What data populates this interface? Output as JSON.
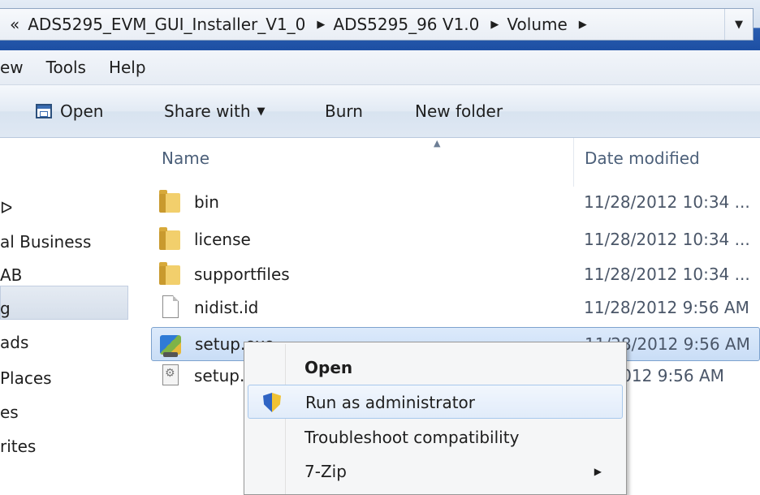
{
  "address_bar": {
    "overflow_glyph": "«",
    "breadcrumbs": [
      "ADS5295_EVM_GUI_Installer_V1_0",
      "ADS5295_96 V1.0",
      "Volume"
    ],
    "separator_glyph": "▶",
    "dropdown_glyph": "▼"
  },
  "menu": {
    "items": [
      "ew",
      "Tools",
      "Help"
    ]
  },
  "toolbar": {
    "open_label": "Open",
    "share_label": "Share with",
    "share_caret": "▼",
    "burn_label": "Burn",
    "new_folder_label": "New folder"
  },
  "nav": {
    "items": [
      "",
      "al Business",
      "AB",
      "g",
      "ads",
      "Places",
      "es",
      "rites"
    ]
  },
  "columns": {
    "name": "Name",
    "date_modified": "Date modified",
    "sort_glyph": "▲"
  },
  "files": [
    {
      "name": "bin",
      "date": "11/28/2012 10:34 ...",
      "icon": "folder-icon"
    },
    {
      "name": "license",
      "date": "11/28/2012 10:34 ...",
      "icon": "folder-icon"
    },
    {
      "name": "supportfiles",
      "date": "11/28/2012 10:34 ...",
      "icon": "folder-icon"
    },
    {
      "name": "nidist.id",
      "date": "11/28/2012 9:56 AM",
      "icon": "file-icon"
    },
    {
      "name": "setup.exe",
      "date": "11/28/2012 9:56 AM",
      "icon": "setup-exe-icon"
    },
    {
      "name": "setup.",
      "date": "8/2012 9:56 AM",
      "icon": "config-file-icon"
    }
  ],
  "context_menu": {
    "items": [
      {
        "label": "Open",
        "bold": true
      },
      {
        "label": "Run as administrator",
        "icon": "uac-shield-icon",
        "highlighted": true
      },
      {
        "label": "Troubleshoot compatibility"
      },
      {
        "label": "7-Zip",
        "submenu": true,
        "submenu_glyph": "▶"
      }
    ]
  },
  "colors": {
    "selection_bg": "#cfe2f8",
    "selection_border": "#7da2ce",
    "title_band": "#1d4fa3",
    "header_text": "#4c607a"
  }
}
